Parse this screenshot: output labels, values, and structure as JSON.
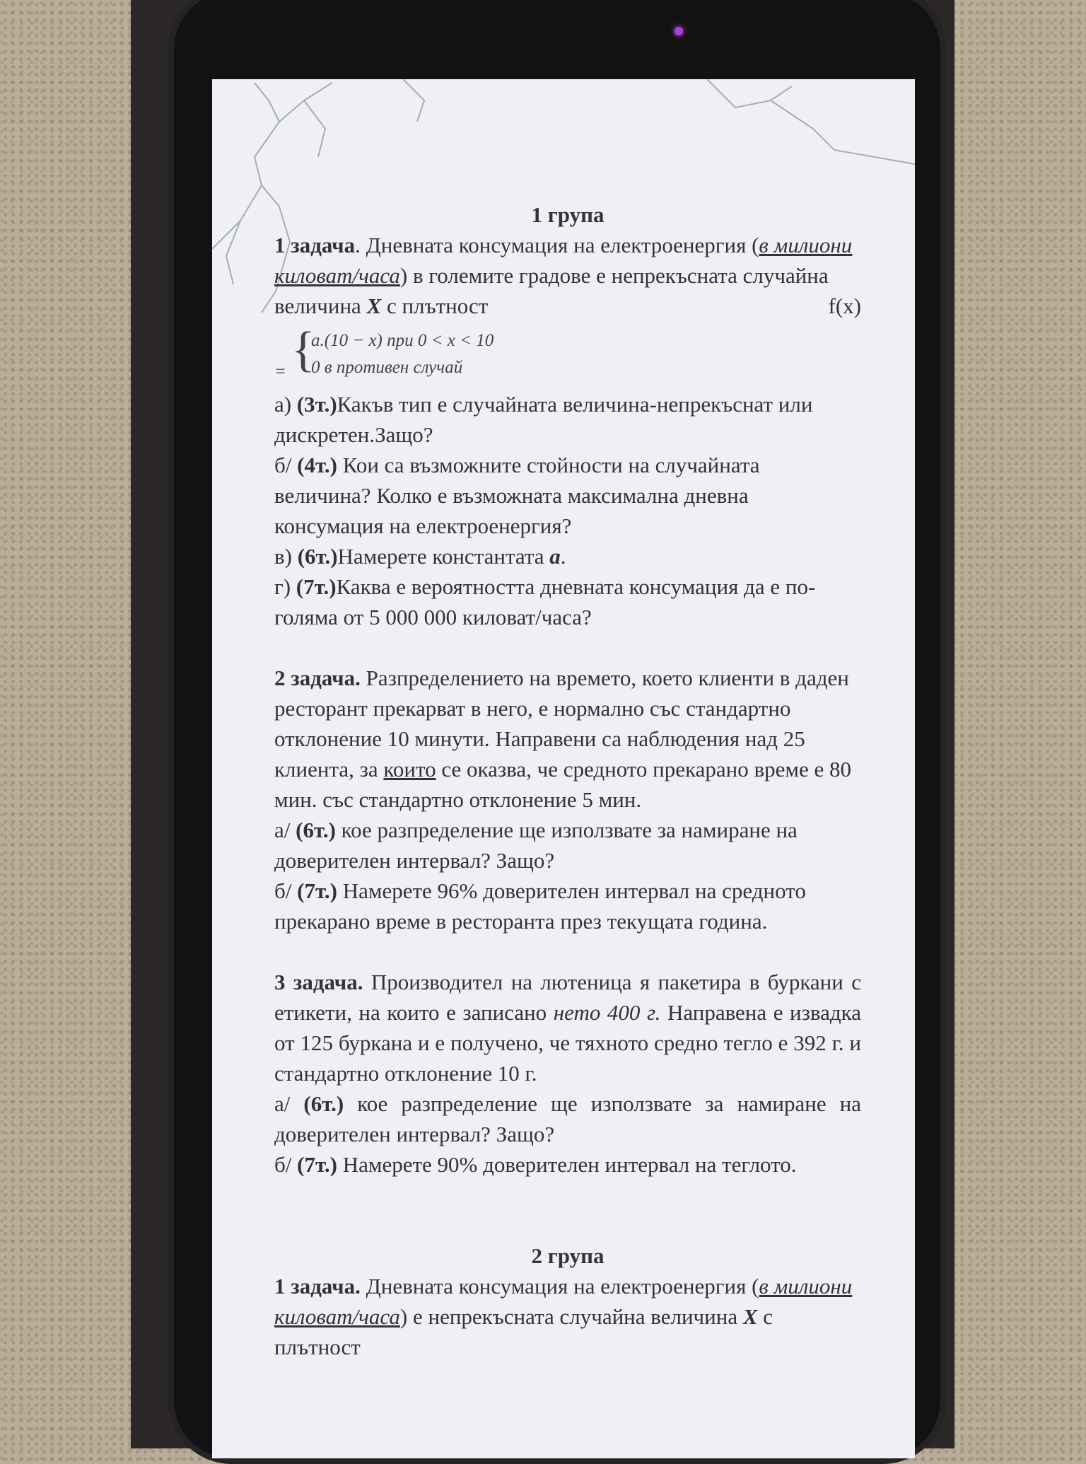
{
  "group1": {
    "title": "1 група",
    "task1": {
      "label": "1 задача",
      "text_a": ". Дневната консумация на електроенергия (",
      "units": "в милиони киловат/часа",
      "text_b": ") в големите градове е непрекъсната случайна величина ",
      "var": "X",
      "text_c": " с плътност",
      "fx": "f(x)",
      "eq": "=",
      "case1": "a.(10 − x)    при   0 <  x < 10",
      "case2": "0       в противен   случай",
      "q_a_prefix": "а) ",
      "q_a_pts": "(3т.)",
      "q_a": "Какъв тип е случайната величина-непрекъснат или дискретен.Защо?",
      "q_b_prefix": "б/ ",
      "q_b_pts": "(4т.)",
      "q_b": " Кои са възможните стойности  на случайната величина? Колко е възможната максимална дневна консумация на електроенергия?",
      "q_c_prefix": "в) ",
      "q_c_pts": "(6т.)",
      "q_c": "Намерете константата ",
      "q_c_var": "a",
      "q_c_end": ".",
      "q_d_prefix": "г) ",
      "q_d_pts": "(7т.)",
      "q_d": "Каква е вероятността дневната консумация да е по-голяма от 5 000 000 киловат/часа?"
    },
    "task2": {
      "label": "2 задача.",
      "text_a": " Разпределението на времето, което клиенти в даден ресторант прекарват в него, е нормално със стандартно отклонение 10 минути. Направени са наблюдения над 25 клиента, за ",
      "underlined": "които",
      "text_b": " се оказва, че средното прекарано време е 80 мин.  със стандартно отклонение 5 мин.",
      "q_a_prefix": "а/ ",
      "q_a_pts": "(6т.)",
      "q_a": "  кое разпределение ще използвате за намиране на доверителен интервал? Защо?",
      "q_b_prefix": "б/ ",
      "q_b_pts": "(7т.)",
      "q_b": " Намерете 96% доверителен интервал на средното прекарано време в ресторанта през текущата година."
    },
    "task3": {
      "label": "3 задача.",
      "text_a": " Производител на лютеница я пакетира в буркани с етикети, на които е записано ",
      "italic": "нето 400 г.",
      "text_b": " Направена е извадка от 125 буркана и е получено, че тяхното средно тегло е 392 г. и стандартно отклонение 10 г.",
      "q_a_prefix": "а/ ",
      "q_a_pts": "(6т.)",
      "q_a": " кое разпределение ще използвате за намиране на доверителен интервал? Защо?",
      "q_b_prefix": "б/ ",
      "q_b_pts": "(7т.)",
      "q_b": " Намерете 90% доверителен интервал на теглото."
    }
  },
  "group2": {
    "title": "2 група",
    "task1": {
      "label": "1 задача.",
      "text_a": "  Дневната консумация на електроенергия (",
      "units": "в милиони киловат/часа",
      "text_b": ") е непрекъсната случайна величина ",
      "var": "X",
      "text_c": " с плътност"
    }
  }
}
